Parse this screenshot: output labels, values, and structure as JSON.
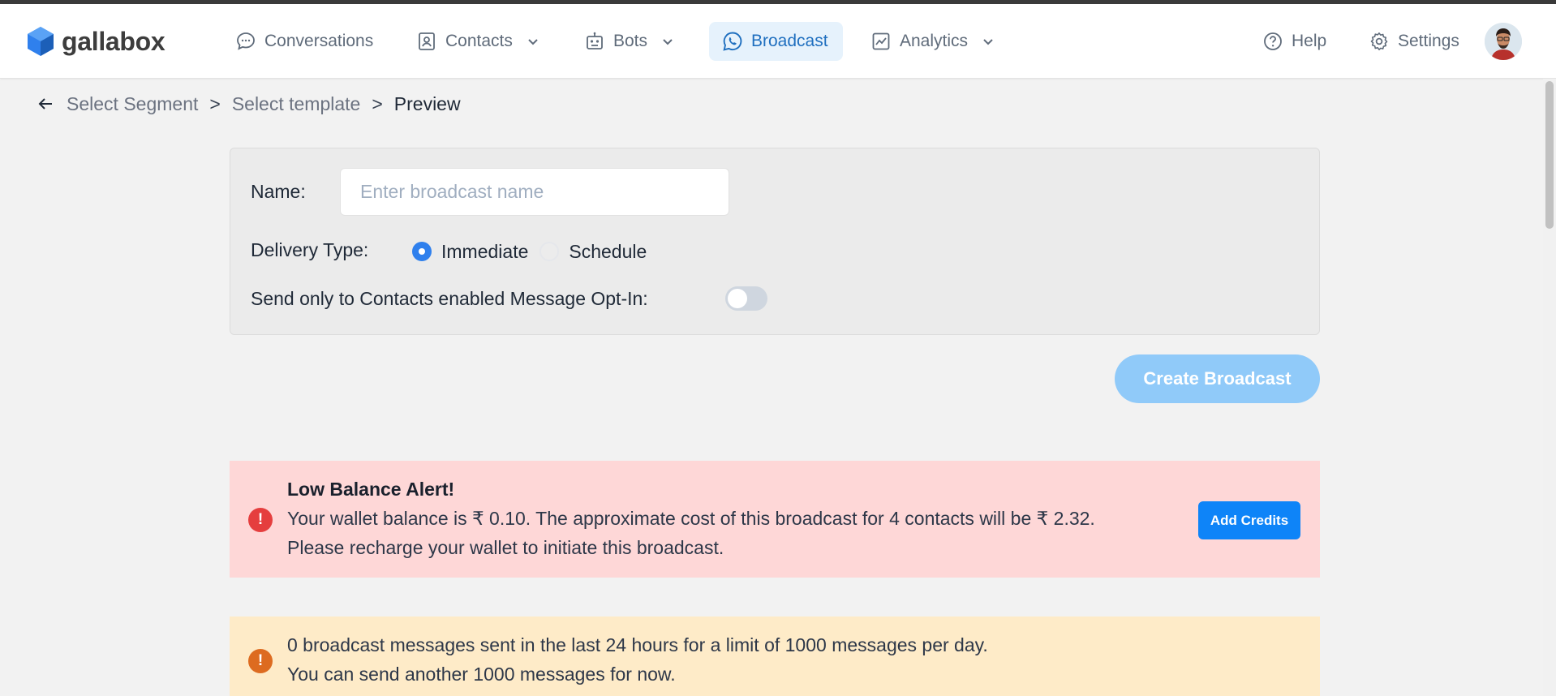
{
  "brand": {
    "name": "gallabox",
    "color": "#2f80ed"
  },
  "nav": {
    "items": [
      {
        "label": "Conversations",
        "icon": "chat-bubble-icon"
      },
      {
        "label": "Contacts",
        "icon": "contact-card-icon",
        "has_dropdown": true
      },
      {
        "label": "Bots",
        "icon": "robot-icon",
        "has_dropdown": true
      },
      {
        "label": "Broadcast",
        "icon": "whatsapp-icon",
        "active": true
      },
      {
        "label": "Analytics",
        "icon": "chart-icon",
        "has_dropdown": true
      }
    ],
    "help": "Help",
    "settings": "Settings"
  },
  "breadcrumb": {
    "steps": [
      "Select Segment",
      "Select template",
      "Preview"
    ],
    "separator": ">"
  },
  "form": {
    "name_label": "Name:",
    "name_placeholder": "Enter broadcast name",
    "name_value": "",
    "delivery_label": "Delivery Type:",
    "delivery_options": [
      "Immediate",
      "Schedule"
    ],
    "delivery_selected": "Immediate",
    "optin_label": "Send only to Contacts enabled Message Opt-In:",
    "optin_enabled": false
  },
  "create_button": "Create Broadcast",
  "alerts": {
    "low_balance": {
      "title": "Low Balance Alert!",
      "line1": "Your wallet balance is ₹ 0.10. The approximate cost of this broadcast for 4 contacts will be ₹ 2.32.",
      "line2": "Please recharge your wallet to initiate this broadcast.",
      "button": "Add Credits",
      "icon_glyph": "!"
    },
    "limit": {
      "line1": "0 broadcast messages sent in the last 24 hours for a limit of 1000 messages per day.",
      "line2": "You can send another 1000 messages for now.",
      "icon_glyph": "!"
    }
  },
  "colors": {
    "accent": "#2f80ed",
    "create_button_disabled": "#90caf9",
    "alert_red_bg": "#fed7d7",
    "alert_yellow_bg": "#feebc8"
  }
}
